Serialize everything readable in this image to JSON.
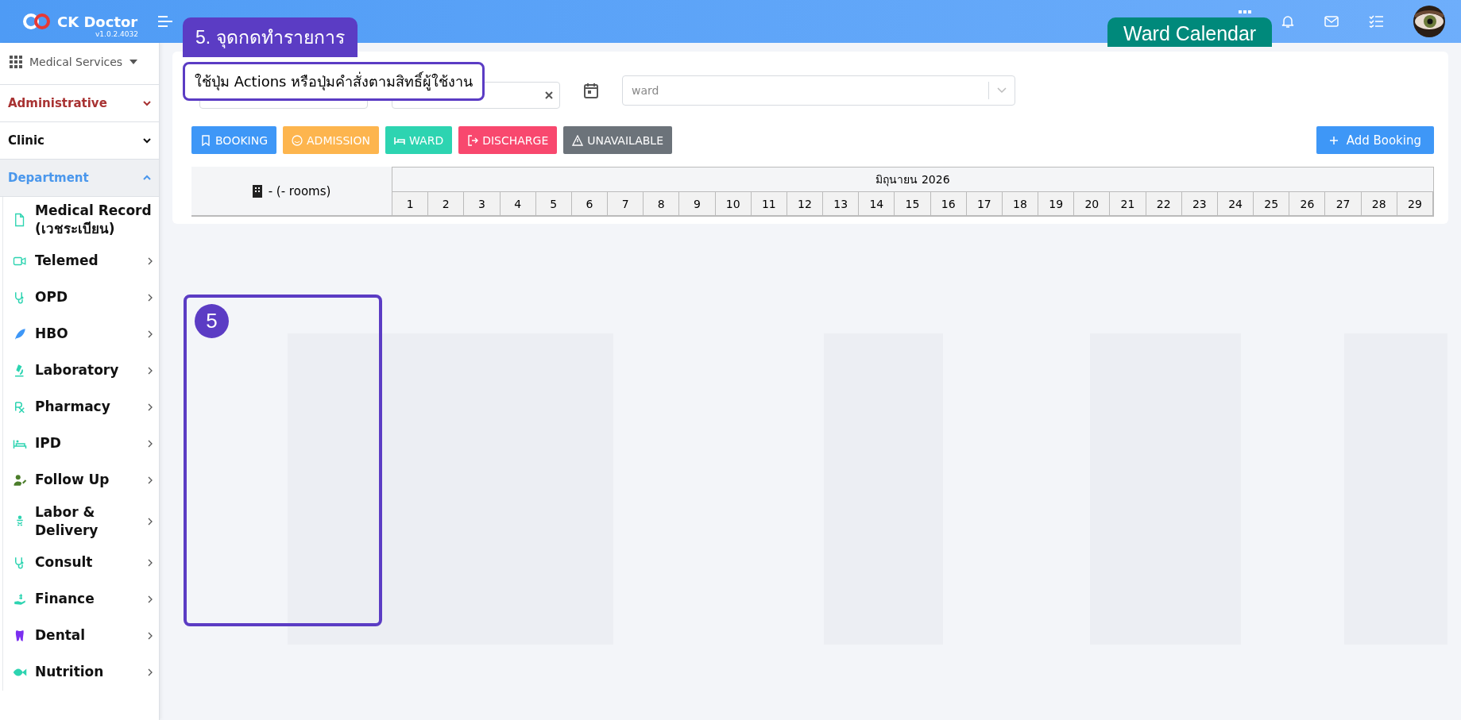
{
  "header": {
    "brand": "CK Doctor",
    "version": "v1.0.2.4032"
  },
  "sidebar": {
    "switcher": "Medical Services",
    "sections": [
      {
        "label": "Administrative",
        "expanded": false,
        "color": "#a83232"
      },
      {
        "label": "Clinic",
        "expanded": false,
        "color": "#111111"
      },
      {
        "label": "Department",
        "expanded": true,
        "color": "#4a97ec",
        "children": [
          {
            "label": "Medical Record (เวชระเบียน)",
            "has_submenu": false
          },
          {
            "label": "Telemed",
            "has_submenu": true
          },
          {
            "label": "OPD",
            "has_submenu": true
          },
          {
            "label": "HBO",
            "has_submenu": true
          },
          {
            "label": "Laboratory",
            "has_submenu": true
          },
          {
            "label": "Pharmacy",
            "has_submenu": true
          },
          {
            "label": "IPD",
            "has_submenu": true
          },
          {
            "label": "Follow Up",
            "has_submenu": true
          },
          {
            "label": "Labor & Delivery",
            "has_submenu": true
          },
          {
            "label": "Consult",
            "has_submenu": true
          },
          {
            "label": "Finance",
            "has_submenu": true
          },
          {
            "label": "Dental",
            "has_submenu": true
          },
          {
            "label": "Nutrition",
            "has_submenu": true
          }
        ]
      }
    ]
  },
  "filters": {
    "ward": {
      "placeholder": "ward"
    }
  },
  "status_buttons": [
    {
      "label": "BOOKING",
      "color": "#3e97f7"
    },
    {
      "label": "ADMISSION",
      "color": "#fdb54e"
    },
    {
      "label": "WARD",
      "color": "#2dd4b1"
    },
    {
      "label": "DISCHARGE",
      "color": "#f8486e"
    },
    {
      "label": "UNAVAILABLE",
      "color": "#6c737a"
    }
  ],
  "add_button": "Add Booking",
  "calendar": {
    "room_label": "- (- rooms)",
    "month": "มิถุนายน 2026",
    "days": [
      "1",
      "2",
      "3",
      "4",
      "5",
      "6",
      "7",
      "8",
      "9",
      "10",
      "11",
      "12",
      "13",
      "14",
      "15",
      "16",
      "17",
      "18",
      "19",
      "20",
      "21",
      "22",
      "23",
      "24",
      "25",
      "26",
      "27",
      "28",
      "29"
    ]
  },
  "annotations": {
    "step_label": "5. จุดกดทำรายการ",
    "note": "ใช้ปุ่ม Actions หรือปุ่มคำสั่งตามสิทธิ์ผู้ใช้งาน",
    "page_label": "Ward Calendar",
    "marker": "5"
  }
}
